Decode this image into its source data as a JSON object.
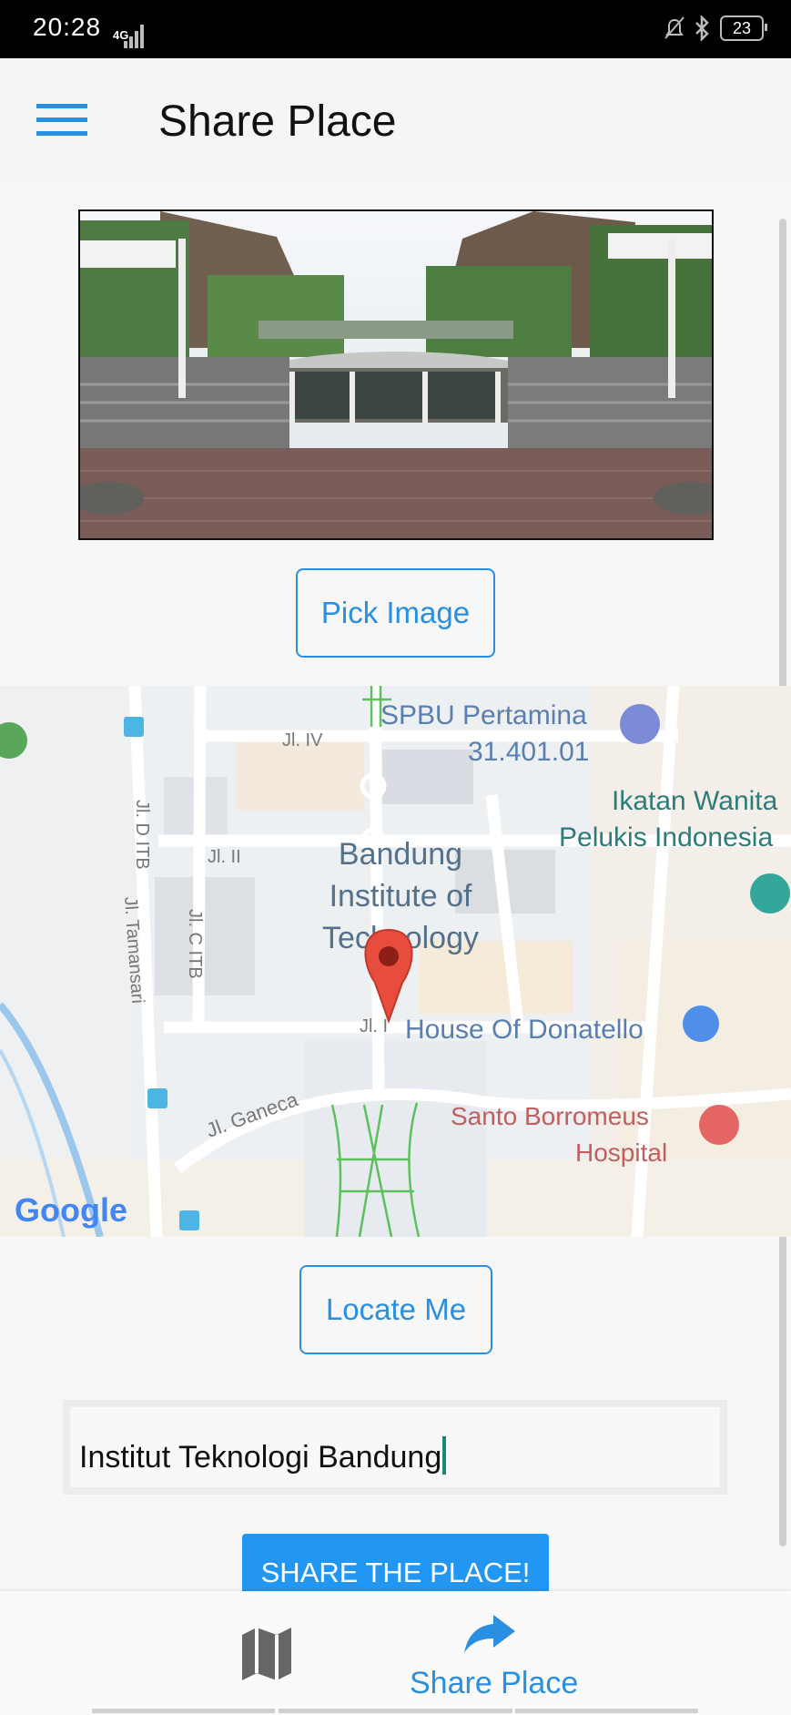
{
  "status": {
    "time": "20:28",
    "network": "4G",
    "battery": "23",
    "icons": [
      "signal-icon",
      "mute-bell-icon",
      "bluetooth-icon",
      "battery-icon"
    ]
  },
  "header": {
    "title": "Share Place",
    "menu_icon": "hamburger-icon"
  },
  "actions": {
    "pick_image": "Pick Image",
    "locate_me": "Locate Me",
    "share": "SHARE THE PLACE!"
  },
  "map": {
    "brand": "Google",
    "labels": {
      "spbu": "SPBU Pertamina",
      "spbu_code": "31.401.01",
      "ikatan_1": "Ikatan Wanita",
      "ikatan_2": "Pelukis Indonesia",
      "itb_1": "Bandung",
      "itb_2": "Institute of",
      "itb_3": "Technology",
      "donatello": "House Of Donatello",
      "hospital_1": "Santo Borromeus",
      "hospital_2": "Hospital",
      "jl_iv": "Jl. IV",
      "jl_ii": "Jl. II",
      "jl_i": "Jl. I",
      "jl_d": "Jl. D ITB",
      "jl_c": "Jl. C ITB",
      "jl_tamansari": "Jl. Tamansari",
      "jl_ganeca": "Jl. Ganeca"
    }
  },
  "form": {
    "place_name": "Institut Teknologi Bandung"
  },
  "bottom_nav": {
    "share_label": "Share Place"
  },
  "colors": {
    "accent": "#2196f3",
    "text": "#111111",
    "pin": "#e53935"
  }
}
